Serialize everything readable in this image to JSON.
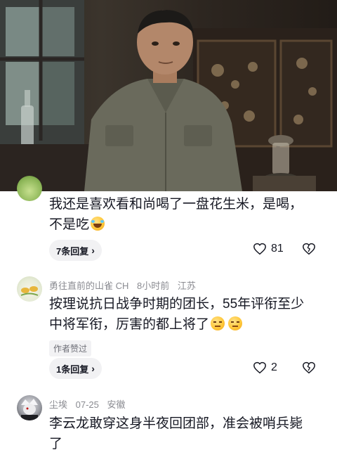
{
  "comments": [
    {
      "text_line1": "我还是喜欢看和尚喝了一盘花生米，是喝，",
      "text_line2": "不是吃",
      "emoji_icon": "laughing-crying-emoji",
      "reply_label": "7条回复",
      "like_count": "81",
      "like_icon": "heart-outline-icon",
      "dislike_icon": "broken-heart-icon"
    },
    {
      "username": "勇往直前的山雀 CH",
      "time": "8小时前",
      "location": "江苏",
      "text_line1": "按理说抗日战争时期的团长，55年评衔至少",
      "text_line2": "中将军衔，厉害的都上将了",
      "emoji_icon": "annoyed-emoji",
      "author_liked": "作者赞过",
      "reply_label": "1条回复",
      "like_count": "2",
      "like_icon": "heart-outline-icon",
      "dislike_icon": "broken-heart-icon"
    },
    {
      "username": "尘埃",
      "time": "07-25",
      "location": "安徽",
      "text_line1": "李云龙敢穿这身半夜回团部，准会被哨兵毙",
      "text_line2": "了"
    }
  ],
  "colors": {
    "text": "#161823",
    "meta": "#8a8b91",
    "pill_bg": "#f1f1f3"
  }
}
